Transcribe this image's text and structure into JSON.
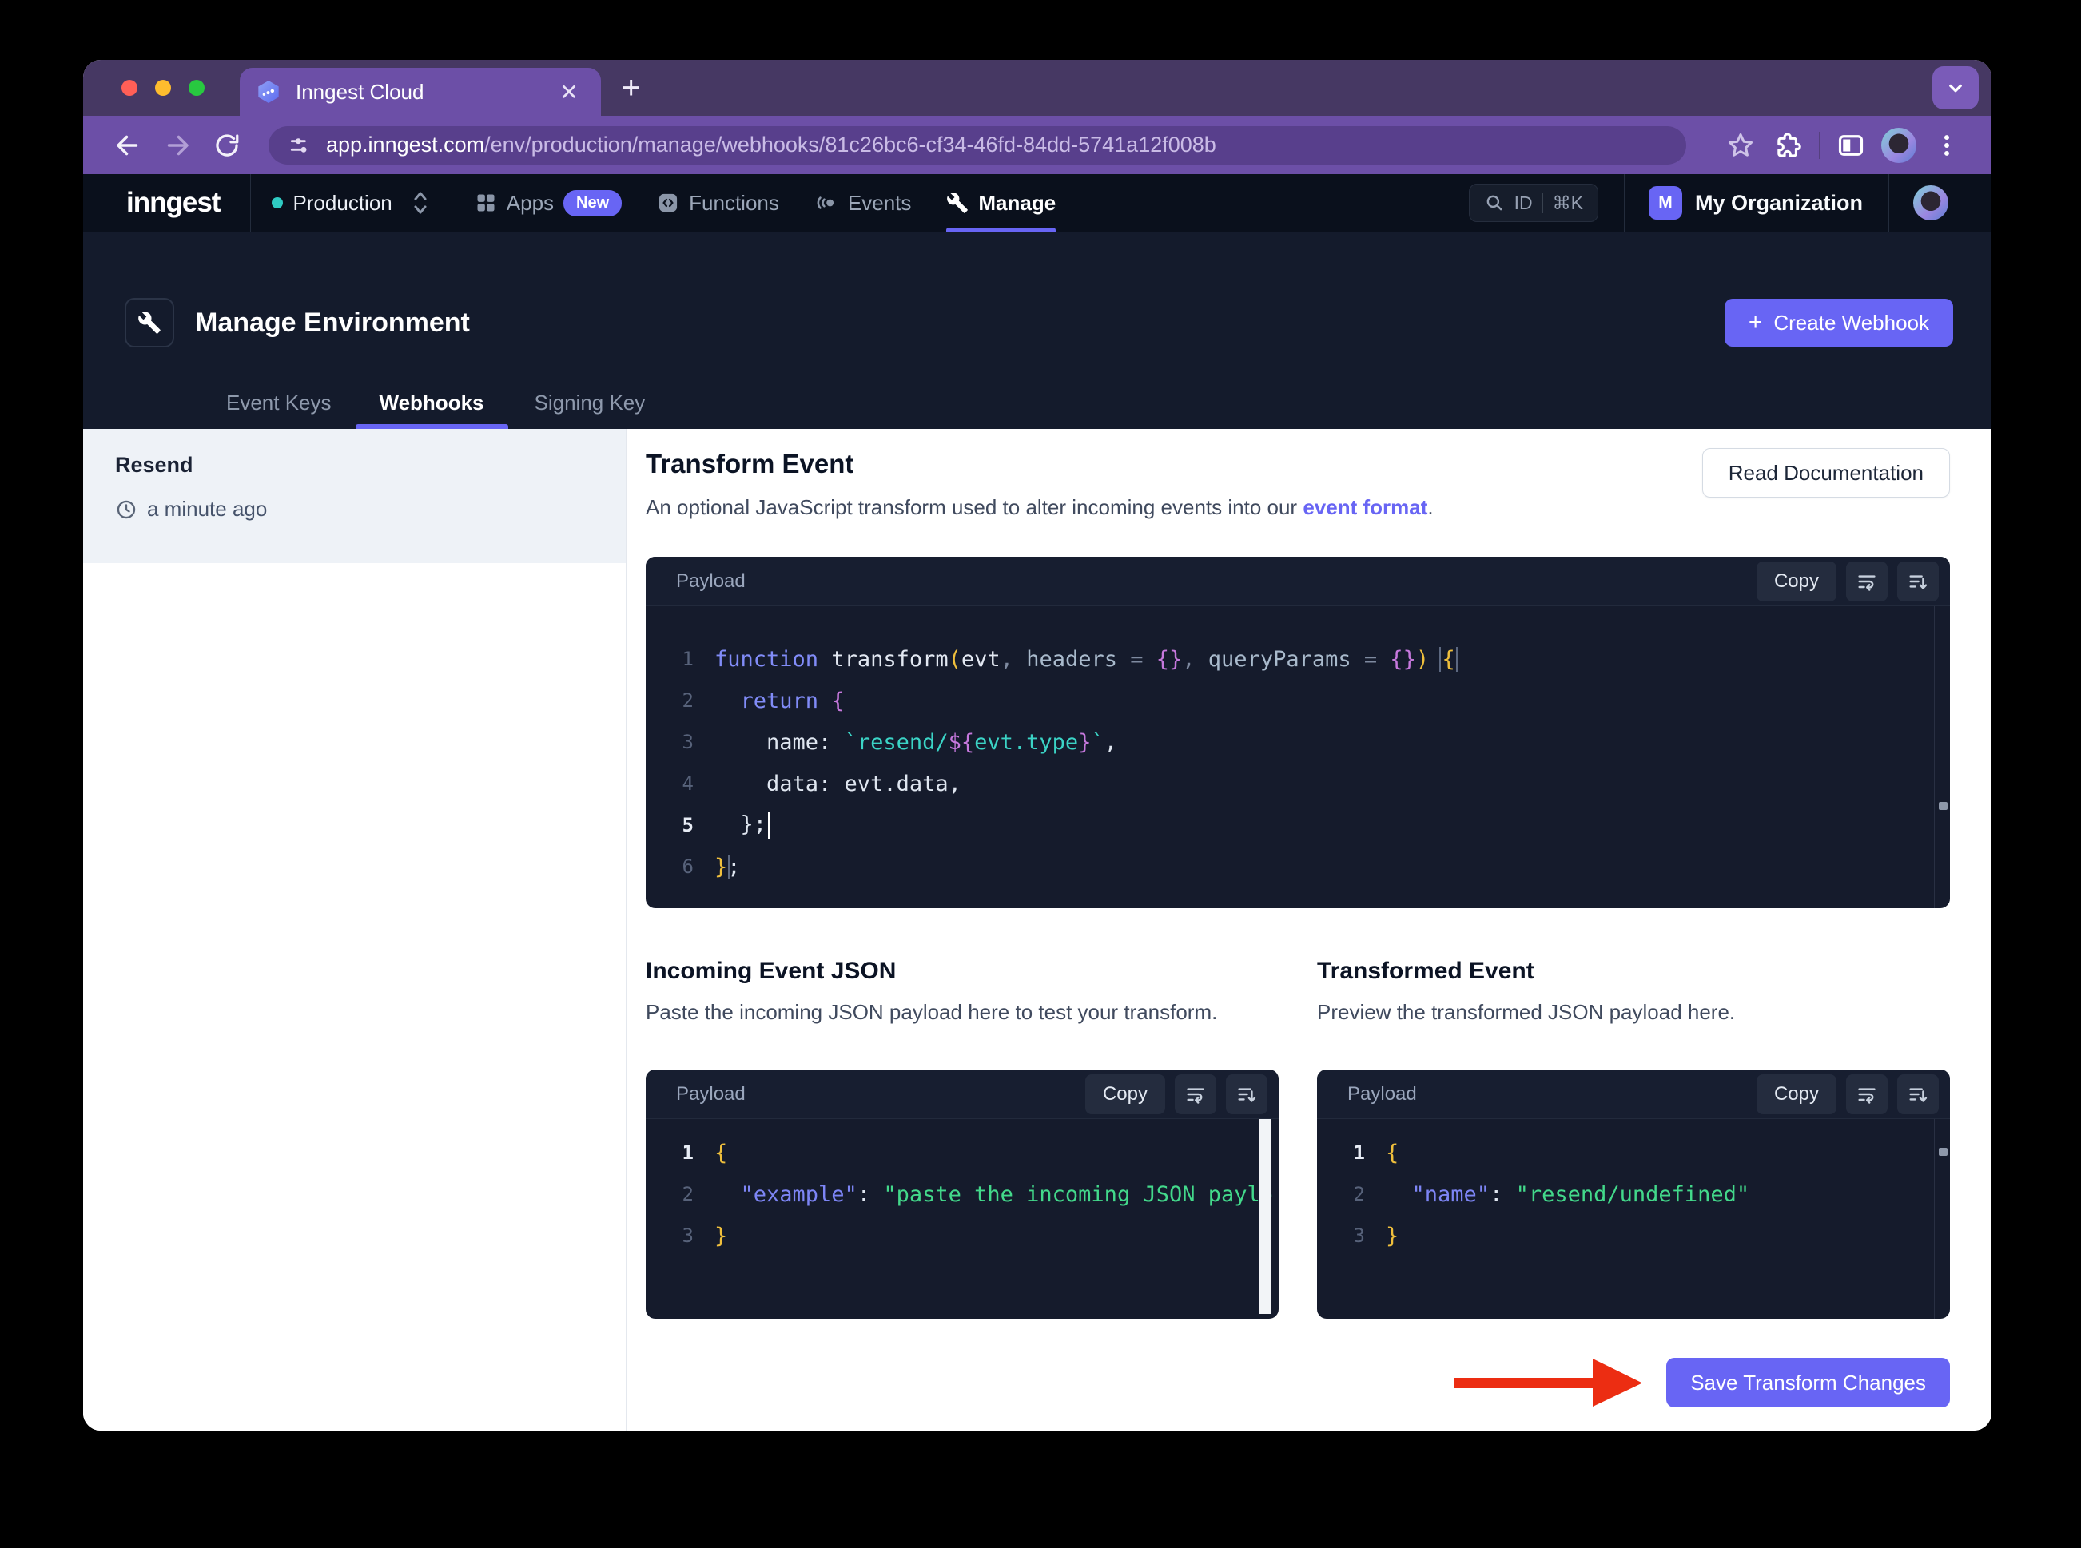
{
  "colors": {
    "accent": "#6865F4",
    "teal_dot": "#2FCBC3",
    "arrow_red": "#EC2D12",
    "chrome_purple": "#6C4FA7"
  },
  "browser": {
    "tab_title": "Inngest Cloud",
    "url_domain": "app.inngest.com",
    "url_path": "/env/production/manage/webhooks/81c26bc6-cf34-46fd-84dd-5741a12f008b"
  },
  "nav": {
    "logo": "inngest",
    "environment": "Production",
    "apps": "Apps",
    "apps_badge": "New",
    "functions": "Functions",
    "events": "Events",
    "manage": "Manage",
    "search_id": "ID",
    "search_shortcut": "⌘K",
    "org_initial": "M",
    "org_name": "My Organization"
  },
  "header": {
    "title": "Manage Environment",
    "create_plus": "+",
    "create_button": "Create Webhook",
    "tab_event_keys": "Event Keys",
    "tab_webhooks": "Webhooks",
    "tab_signing_key": "Signing Key"
  },
  "sidebar": {
    "item_name": "Resend",
    "item_time": "a minute ago"
  },
  "main": {
    "title": "Transform Event",
    "description_prefix": "An optional JavaScript transform used to alter incoming events into our ",
    "description_link": "event format",
    "description_suffix": ".",
    "read_docs": "Read Documentation",
    "editor_label": "Payload",
    "copy_label": "Copy",
    "incoming_title": "Incoming Event JSON",
    "incoming_desc": "Paste the incoming JSON payload here to test your transform.",
    "transformed_title": "Transformed Event",
    "transformed_desc": "Preview the transformed JSON payload here.",
    "save_button": "Save Transform Changes"
  },
  "editors": {
    "transform": {
      "lines": [
        {
          "num": "1",
          "tokens": [
            {
              "t": "function",
              "c": "kw"
            },
            {
              "t": " ",
              "c": "pu"
            },
            {
              "t": "transform",
              "c": "id"
            },
            {
              "t": "(",
              "c": "y"
            },
            {
              "t": "evt",
              "c": "id"
            },
            {
              "t": ", ",
              "c": "pu"
            },
            {
              "t": "headers",
              "c": "pm"
            },
            {
              "t": " = ",
              "c": "pu"
            },
            {
              "t": "{}",
              "c": "br"
            },
            {
              "t": ", ",
              "c": "pu"
            },
            {
              "t": "queryParams",
              "c": "pm"
            },
            {
              "t": " = ",
              "c": "pu"
            },
            {
              "t": "{}",
              "c": "br"
            },
            {
              "t": ")",
              "c": "y"
            },
            {
              "t": " ",
              "c": "pu"
            },
            {
              "t": "{",
              "c": "y",
              "box": true
            }
          ]
        },
        {
          "num": "2",
          "tokens": [
            {
              "t": "  ",
              "c": "pu"
            },
            {
              "t": "return",
              "c": "kw"
            },
            {
              "t": " ",
              "c": "pu"
            },
            {
              "t": "{",
              "c": "br"
            }
          ]
        },
        {
          "num": "3",
          "tokens": [
            {
              "t": "    ",
              "c": "pu"
            },
            {
              "t": "name: ",
              "c": "wh"
            },
            {
              "t": "`resend/",
              "c": "str"
            },
            {
              "t": "${",
              "c": "br"
            },
            {
              "t": "evt.type",
              "c": "str"
            },
            {
              "t": "}",
              "c": "br"
            },
            {
              "t": "`",
              "c": "str"
            },
            {
              "t": ",",
              "c": "wh"
            }
          ]
        },
        {
          "num": "4",
          "tokens": [
            {
              "t": "    data: evt.data,",
              "c": "wh"
            }
          ]
        },
        {
          "num": "5",
          "active": true,
          "cursor": true,
          "tokens": [
            {
              "t": "  };",
              "c": "wh"
            }
          ]
        },
        {
          "num": "6",
          "tokens": [
            {
              "t": "}",
              "c": "y",
              "box": true
            },
            {
              "t": ";",
              "c": "wh"
            }
          ]
        }
      ]
    },
    "incoming": {
      "lines": [
        {
          "num": "1",
          "active": true,
          "tokens": [
            {
              "t": "{",
              "c": "y"
            }
          ]
        },
        {
          "num": "2",
          "tokens": [
            {
              "t": "  ",
              "c": "pu"
            },
            {
              "t": "\"example\"",
              "c": "jkey"
            },
            {
              "t": ": ",
              "c": "wh"
            },
            {
              "t": "\"paste the incoming JSON paylo",
              "c": "jstr"
            }
          ]
        },
        {
          "num": "3",
          "tokens": [
            {
              "t": "}",
              "c": "y"
            }
          ]
        }
      ]
    },
    "transformed": {
      "lines": [
        {
          "num": "1",
          "active": true,
          "tokens": [
            {
              "t": "{",
              "c": "y"
            }
          ]
        },
        {
          "num": "2",
          "tokens": [
            {
              "t": "  ",
              "c": "pu"
            },
            {
              "t": "\"name\"",
              "c": "jkey"
            },
            {
              "t": ": ",
              "c": "wh"
            },
            {
              "t": "\"resend/undefined\"",
              "c": "jstr"
            }
          ]
        },
        {
          "num": "3",
          "tokens": [
            {
              "t": "}",
              "c": "y"
            }
          ]
        }
      ]
    }
  }
}
